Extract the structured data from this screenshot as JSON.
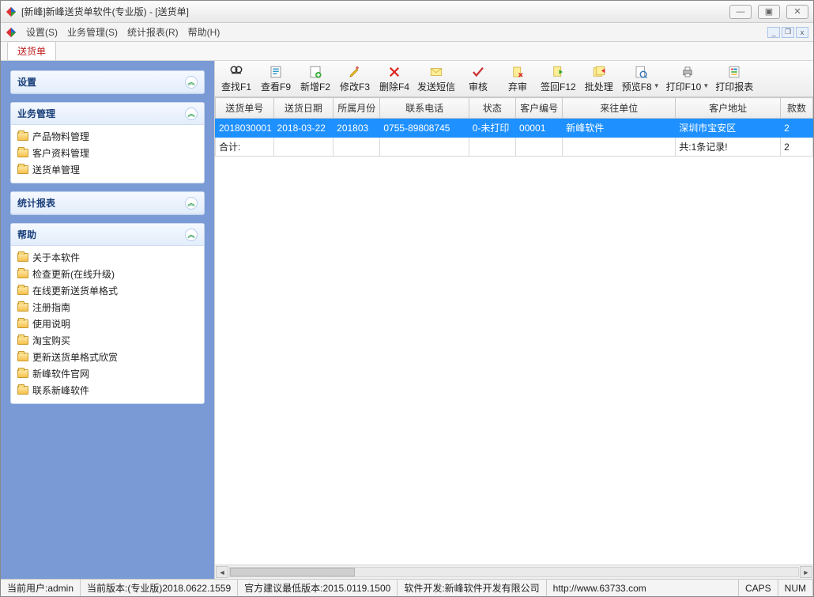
{
  "window": {
    "title": "[新峰]新峰送货单软件(专业版)  -  [送货单]"
  },
  "menu": {
    "settings": "设置(S)",
    "business": "业务管理(S)",
    "reports": "统计报表(R)",
    "help": "帮助(H)"
  },
  "tab": {
    "label": "送货单"
  },
  "sidebar": {
    "groups": [
      {
        "title": "设置",
        "items": []
      },
      {
        "title": "业务管理",
        "items": [
          "产品物料管理",
          "客户资料管理",
          "送货单管理"
        ]
      },
      {
        "title": "统计报表",
        "items": []
      },
      {
        "title": "帮助",
        "items": [
          "关于本软件",
          "检查更新(在线升级)",
          "在线更新送货单格式",
          "注册指南",
          "使用说明",
          "淘宝购买",
          "更新送货单格式欣赏",
          "新峰软件官网",
          "联系新峰软件"
        ]
      }
    ]
  },
  "toolbar": {
    "buttons": [
      {
        "key": "find",
        "label": "查找F1"
      },
      {
        "key": "view",
        "label": "查看F9"
      },
      {
        "key": "new",
        "label": "新增F2"
      },
      {
        "key": "edit",
        "label": "修改F3"
      },
      {
        "key": "delete",
        "label": "删除F4"
      },
      {
        "key": "sms",
        "label": "发送短信"
      },
      {
        "key": "approve",
        "label": "审核"
      },
      {
        "key": "unapprove",
        "label": "弃审"
      },
      {
        "key": "signback",
        "label": "签回F12"
      },
      {
        "key": "batch",
        "label": "批处理"
      },
      {
        "key": "preview",
        "label": "预览F8",
        "dropdown": true
      },
      {
        "key": "print",
        "label": "打印F10",
        "dropdown": true
      },
      {
        "key": "printrpt",
        "label": "打印报表"
      }
    ]
  },
  "grid": {
    "columns": [
      "送货单号",
      "送货日期",
      "所属月份",
      "联系电话",
      "状态",
      "客户编号",
      "来往单位",
      "客户地址",
      "款数"
    ],
    "row": {
      "c0": "2018030001",
      "c1": "2018-03-22",
      "c2": "201803",
      "c3": "0755-89808745",
      "c4": "0-未打印",
      "c5": "00001",
      "c6": "新峰软件",
      "c7": "深圳市宝安区",
      "c8": "2"
    },
    "sum": {
      "label": "合计:",
      "records": "共:1条记录!",
      "count": "2"
    }
  },
  "status": {
    "user": "当前用户:admin",
    "version": "当前版本:(专业版)2018.0622.1559",
    "minversion": "官方建议最低版本:2015.0119.1500",
    "dev": "软件开发:新峰软件开发有限公司",
    "url": "http://www.63733.com",
    "caps": "CAPS",
    "num": "NUM"
  }
}
